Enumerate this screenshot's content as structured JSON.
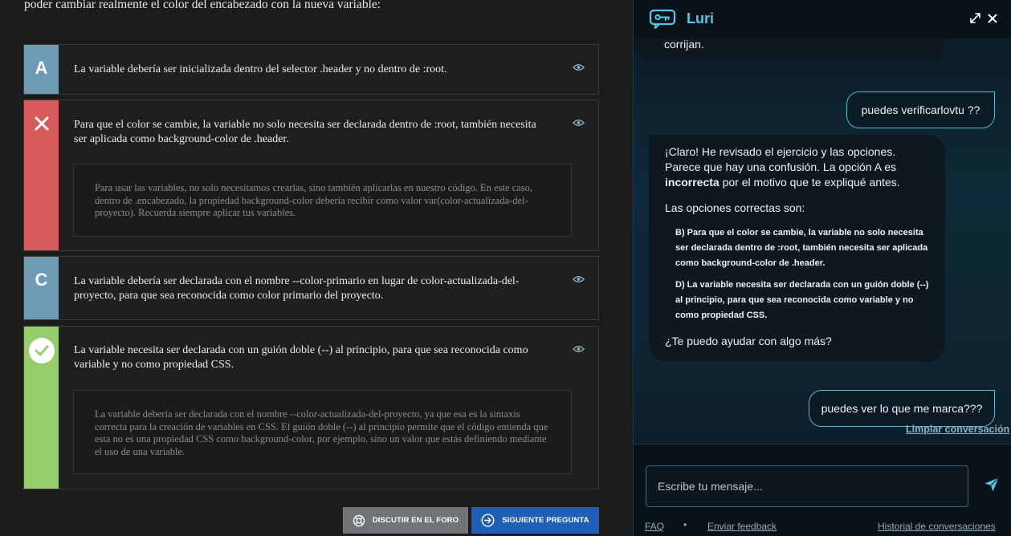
{
  "quiz": {
    "question_tail": "poder cambiar realmente el color del encabezado con la nueva variable:",
    "options": [
      {
        "letter": "A",
        "text": "La variable debería ser inicializada dentro del selector .header y no dentro de :root.",
        "state": "neutral"
      },
      {
        "letter": "B",
        "text": "Para que el color se cambie, la variable no solo necesita ser declarada dentro de :root, también necesita ser aplicada como background-color de .header.",
        "state": "incorrect",
        "explanation": "Para usar las variables, no solo necesitamos crearlas, sino también aplicarlas en nuestro código. En este caso, dentro de .encabezado, la propiedad background-color debería recibir como valor var(color-actualizada-del-proyecto). Recuerda siempre aplicar tus variables."
      },
      {
        "letter": "C",
        "text": "La variable debería ser declarada con el nombre --color-primario en lugar de color-actualizada-del-proyecto, para que sea reconocida como color primario del proyecto.",
        "state": "neutral"
      },
      {
        "letter": "D",
        "text": "La variable necesita ser declarada con un guión doble (--) al principio, para que sea reconocida como variable y no como propiedad CSS.",
        "state": "correct",
        "explanation": "La variable debería ser declarada con el nombre --color-actualizada-del-proyecto, ya que esa es la sintaxis correcta para la creación de variables en CSS. El guión doble (--) al principio permite que el código entienda que esta no es una propiedad CSS como background-color, por ejemplo, sino un valor que estás definiendo mediante el uso de una variable."
      }
    ],
    "forum_button": "DISCUTIR EN EL FORO",
    "next_button": "SIGUIENTE PREGUNTA"
  },
  "chat": {
    "title": "Luri",
    "messages": {
      "prev_bot_tail": "corrijan.",
      "user_1": "puedes verificarlovtu ??",
      "bot_p1_before": "¡Claro! He revisado el ejercicio y las opciones. Parece que hay una confusión. La opción A es ",
      "bot_p1_strong": "incorrecta",
      "bot_p1_after": " por el motivo que te expliqué antes.",
      "bot_p2": "Las opciones correctas son:",
      "bot_item_b": "B) Para que el color se cambie, la variable no solo necesita ser declarada dentro de :root, también necesita ser aplicada como background-color de .header.",
      "bot_item_d": "D) La variable necesita ser declarada con un guión doble (--) al principio, para que sea reconocida como variable y no como propiedad CSS.",
      "bot_p3": "¿Te puedo ayudar con algo más?",
      "user_2": "puedes ver lo que me marca???"
    },
    "clear_link": "Limpiar conversación",
    "input_placeholder": "Escribe tu mensaje...",
    "footer": {
      "faq": "FAQ",
      "dot": "•",
      "feedback": "Enviar feedback",
      "history": "Historial de conversaciones"
    }
  },
  "colors": {
    "badge_neutral": "#6d9ab4",
    "badge_incorrect": "#d65a5a",
    "badge_correct": "#96cd6b",
    "accent": "#4fc8ea",
    "next_button": "#1f5fb8",
    "forum_button": "#6f7479"
  },
  "icons": [
    "eye-icon",
    "close-x-icon",
    "check-icon",
    "lifebuoy-icon",
    "arrow-right-circle-icon",
    "luri-logo-icon",
    "expand-icon",
    "close-icon",
    "send-icon"
  ]
}
